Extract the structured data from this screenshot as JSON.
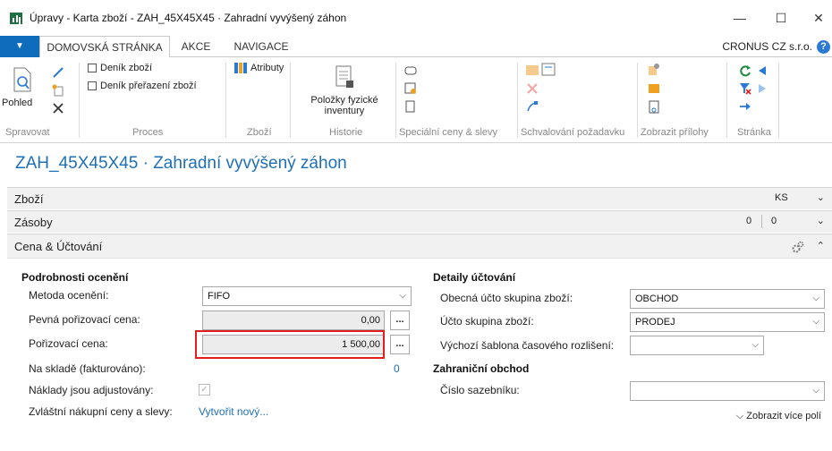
{
  "window": {
    "title": "Úpravy - Karta zboží - ZAH_45X45X45 · Zahradní vyvýšený záhon",
    "minimize": "—",
    "maximize": "☐",
    "close": "✕"
  },
  "tabs": {
    "file": "▼",
    "items": [
      "DOMOVSKÁ STRÁNKA",
      "AKCE",
      "NAVIGACE"
    ],
    "active": "DOMOVSKÁ STRÁNKA",
    "company": "CRONUS CZ s.r.o.",
    "help": "?"
  },
  "ribbon": {
    "groups": {
      "spravovat": {
        "label": "Spravovat",
        "pohled": "Pohled"
      },
      "proces": {
        "label": "Proces",
        "items": [
          "Deník zboží",
          "Deník přeřazení zboží"
        ]
      },
      "zbozi": {
        "label": "Zboží",
        "items": [
          "Atributy"
        ]
      },
      "historie": {
        "label": "Historie",
        "big_button": "Položky fyzické inventury"
      },
      "specialni": {
        "label": "Speciální ceny & slevy"
      },
      "schvalovani": {
        "label": "Schvalování požadavku"
      },
      "prilohy": {
        "label": "Zobrazit přílohy"
      },
      "stranka": {
        "label": "Stránka"
      }
    }
  },
  "page": {
    "title": "ZAH_45X45X45 · Zahradní vyvýšený záhon"
  },
  "fasttabs": {
    "zbozi": {
      "title": "Zboží",
      "right": "KS",
      "chevron": "⌄"
    },
    "zasoby": {
      "title": "Zásoby",
      "right1": "0",
      "right2": "0",
      "chevron": "⌄"
    },
    "cena": {
      "title": "Cena & Účtování",
      "chevron": "⌃"
    }
  },
  "left_section": {
    "heading": "Podrobnosti ocenění",
    "fields": {
      "metoda": {
        "label": "Metoda ocenění:",
        "value": "FIFO"
      },
      "pevna": {
        "label": "Pevná pořizovací cena:",
        "value": "0,00"
      },
      "porizovaci": {
        "label": "Pořizovací cena:",
        "value": "1 500,00"
      },
      "na_sklade": {
        "label": "Na skladě (fakturováno):",
        "value": "0"
      },
      "naklady": {
        "label": "Náklady jsou adjustovány:",
        "checked": true
      },
      "zvlastni": {
        "label": "Zvláštní nákupní ceny a slevy:",
        "link": "Vytvořit nový..."
      }
    },
    "ellipsis": "..."
  },
  "right_section": {
    "heading": "Detaily účtování",
    "fields": {
      "obecna": {
        "label": "Obecná účto skupina zboží:",
        "value": "OBCHOD"
      },
      "ucto": {
        "label": "Účto skupina zboží:",
        "value": "PRODEJ"
      },
      "sablona": {
        "label": "Výchozí šablona časového rozlišení:",
        "value": ""
      }
    },
    "heading2": "Zahraniční obchod",
    "fields2": {
      "cislo": {
        "label": "Číslo sazebníku:",
        "value": ""
      }
    }
  },
  "footer": {
    "more": "Zobrazit více polí"
  },
  "colors": {
    "accent": "#1f6fb5",
    "highlight": "#e02020",
    "file_tab": "#0f6cbd"
  }
}
